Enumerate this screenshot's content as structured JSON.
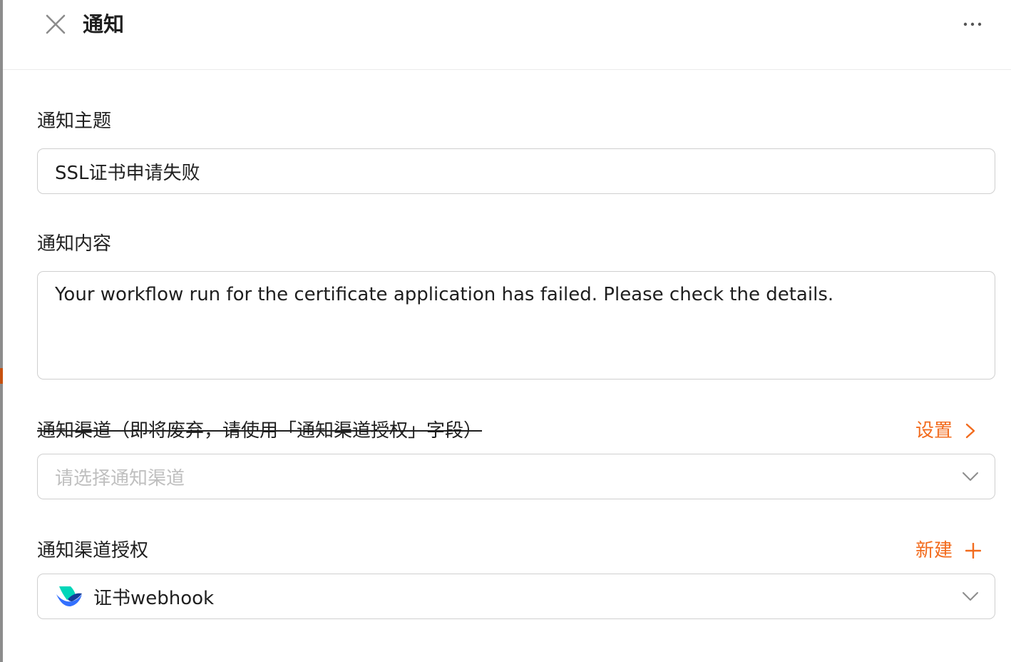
{
  "header": {
    "title": "通知",
    "close_icon": "close-icon",
    "more_icon": "more-horizontal-icon"
  },
  "form": {
    "subject": {
      "label": "通知主题",
      "value": "SSL证书申请失败"
    },
    "content": {
      "label": "通知内容",
      "value": "Your workflow run for the certificate application has failed. Please check the details."
    },
    "channel": {
      "label": "通知渠道（即将废弃，请使用「通知渠道授权」字段）",
      "placeholder": "请选择通知渠道",
      "action_label": "设置",
      "action_icon": "chevron-right-icon",
      "dropdown_icon": "chevron-down-icon"
    },
    "channel_auth": {
      "label": "通知渠道授权",
      "selected": "证书webhook",
      "selected_icon": "lark-logo-icon",
      "action_label": "新建",
      "action_icon": "plus-icon",
      "dropdown_icon": "chevron-down-icon"
    }
  },
  "colors": {
    "accent": "#f26b1d",
    "text": "#1f1f1f",
    "placeholder": "#bfbfbf",
    "border": "#cfcfcf",
    "icon_gray": "#8c8c8c",
    "left_edge_accent": "#c7510f"
  }
}
